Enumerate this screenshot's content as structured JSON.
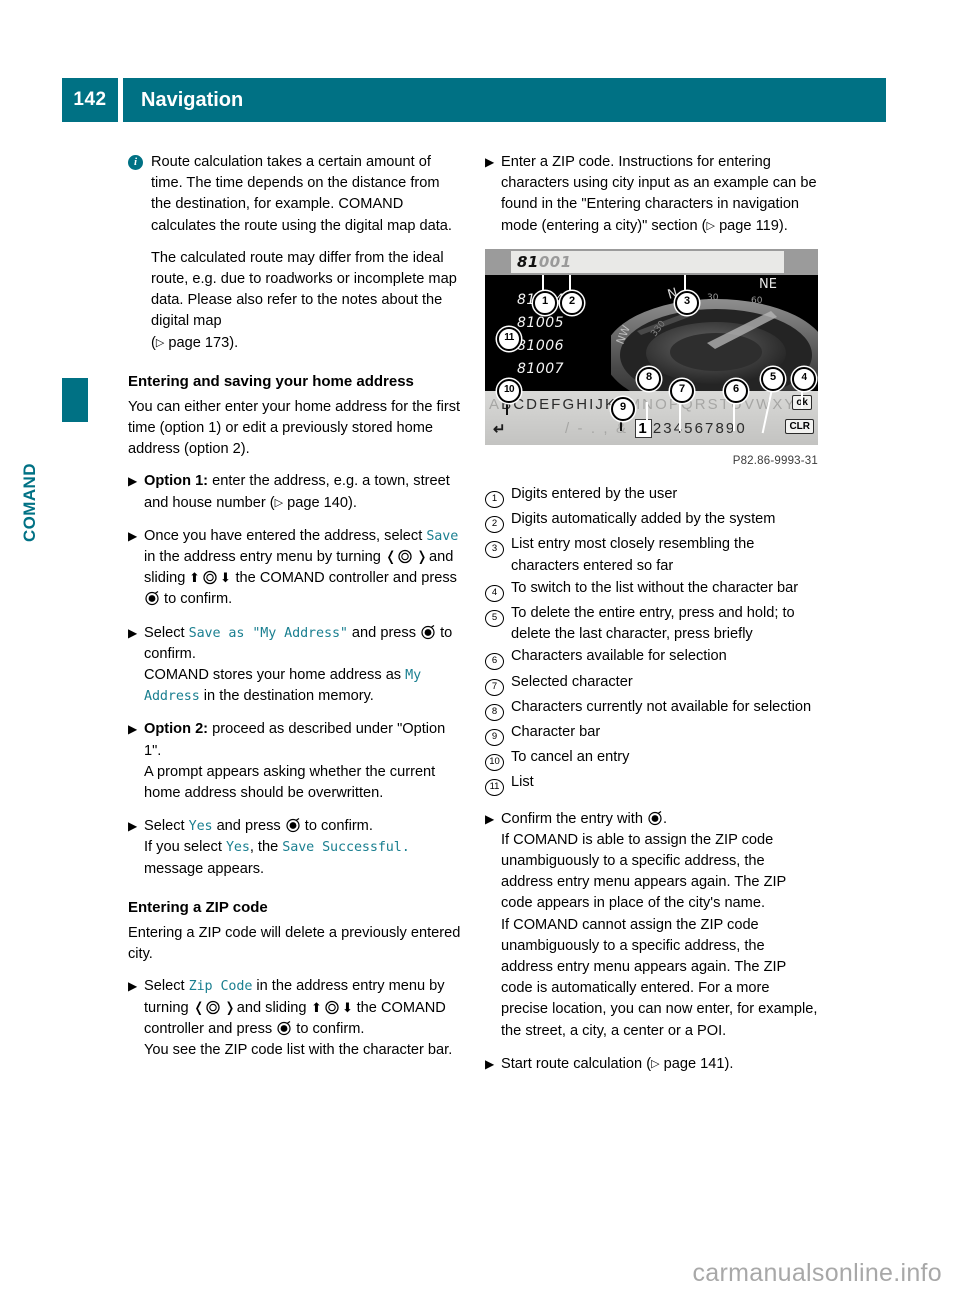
{
  "header": {
    "page_number": "142",
    "title": "Navigation"
  },
  "side_tab": {
    "label": "COMAND"
  },
  "left_column": {
    "note": {
      "icon": "info-icon",
      "paragraphs": [
        "Route calculation takes a certain amount of time. The time depends on the distance from the destination, for example. COMAND calculates the route using the digital map data.",
        "The calculated route may differ from the ideal route, e.g. due to roadworks or incomplete map data. Please also refer to the notes about the digital map"
      ],
      "page_ref": "page 173"
    },
    "heading_home": "Entering and saving your home address",
    "intro_home": "You can either enter your home address for the first time (option 1) or edit a previously stored home address (option 2).",
    "step_option1": {
      "bold": "Option 1:",
      "text": " enter the address, e.g. a town, street and house number (",
      "page_ref": "page 140",
      "tail": ")."
    },
    "step_save": {
      "lead": "Once you have entered the address, select ",
      "cmd": "Save",
      "mid1": " in the address entry menu by turning ",
      "mid2": " and sliding ",
      "mid3": " the COMAND controller and press ",
      "tail": " to confirm."
    },
    "step_save_as": {
      "lead": "Select ",
      "cmd": "Save as \"My Address\"",
      "mid": " and press ",
      "tail": " to confirm.",
      "follow_lead": "COMAND stores your home address as ",
      "follow_cmd": "My Address",
      "follow_tail": " in the destination memory."
    },
    "step_option2": {
      "bold": "Option 2:",
      "text": " proceed as described under \"Option 1\".",
      "follow": "A prompt appears asking whether the current home address should be overwritten."
    },
    "step_yes": {
      "lead": "Select ",
      "cmd": "Yes",
      "mid": " and press ",
      "tail": " to confirm.",
      "follow_lead": "If you select ",
      "follow_cmd1": "Yes",
      "follow_mid": ", the ",
      "follow_cmd2": "Save Successful.",
      "follow_tail": " message appears."
    },
    "heading_zip": "Entering a ZIP code",
    "intro_zip": "Entering a ZIP code will delete a previously entered city.",
    "step_zip": {
      "lead": "Select ",
      "cmd": "Zip Code",
      "mid1": " in the address entry menu by turning ",
      "mid2": " and sliding ",
      "mid3": " the COMAND controller and press ",
      "tail": " to confirm.",
      "follow": "You see the ZIP code list with the character bar."
    }
  },
  "right_column": {
    "step_enter_zip": {
      "text": "Enter a ZIP code. Instructions for entering characters using city input as an example can be found in the \"Entering characters in navigation mode (entering a city)\" section (",
      "page_ref": "page 119",
      "tail": ")."
    },
    "device_screenshot": {
      "entry_typed": "81",
      "entry_auto": "001",
      "list_items": [
        "81004",
        "81005",
        "81006",
        "81007"
      ],
      "compass_labels": [
        "N",
        "NE",
        "NW",
        "30",
        "60",
        "330"
      ],
      "char_row_alpha": "ABCDEFGHIJKLMNOPQRSTUVWXYZ",
      "char_row_symbols": "/ -  . , &",
      "char_row_digits_before": "",
      "char_selected": "1",
      "char_row_digits": "234567890",
      "ok_button": "ok",
      "clr_button": "CLR",
      "back_button": "back-arrow",
      "callouts": [
        "1",
        "2",
        "3",
        "4",
        "5",
        "6",
        "7",
        "8",
        "9",
        "10",
        "11"
      ]
    },
    "caption": "P82.86-9993-31",
    "legend": [
      {
        "num": "1",
        "text": "Digits entered by the user"
      },
      {
        "num": "2",
        "text": "Digits automatically added by the system"
      },
      {
        "num": "3",
        "text": "List entry most closely resembling the characters entered so far"
      },
      {
        "num": "4",
        "text": "To switch to the list without the character bar"
      },
      {
        "num": "5",
        "text": "To delete the entire entry, press and hold; to delete the last character, press briefly"
      },
      {
        "num": "6",
        "text": "Characters available for selection"
      },
      {
        "num": "7",
        "text": "Selected character"
      },
      {
        "num": "8",
        "text": "Characters currently not available for selection"
      },
      {
        "num": "9",
        "text": "Character bar"
      },
      {
        "num": "10",
        "text": "To cancel an entry"
      },
      {
        "num": "11",
        "text": "List"
      }
    ],
    "step_confirm": {
      "lead": "Confirm the entry with ",
      "tail": ".",
      "p1": "If COMAND is able to assign the ZIP code unambiguously to a specific address, the address entry menu appears again. The ZIP code appears in place of the city's name.",
      "p2": "If COMAND cannot assign the ZIP code unambiguously to a specific address, the address entry menu appears again. The ZIP code is automatically entered. For a more precise location, you can now enter, for example, the street, a city, a center or a POI."
    },
    "step_start_route": {
      "text": "Start route calculation (",
      "page_ref": "page 141",
      "tail": ")."
    }
  },
  "watermark": "carmanualsonline.info",
  "colors": {
    "brand_teal": "#007184",
    "command_text": "#1a7f90"
  }
}
